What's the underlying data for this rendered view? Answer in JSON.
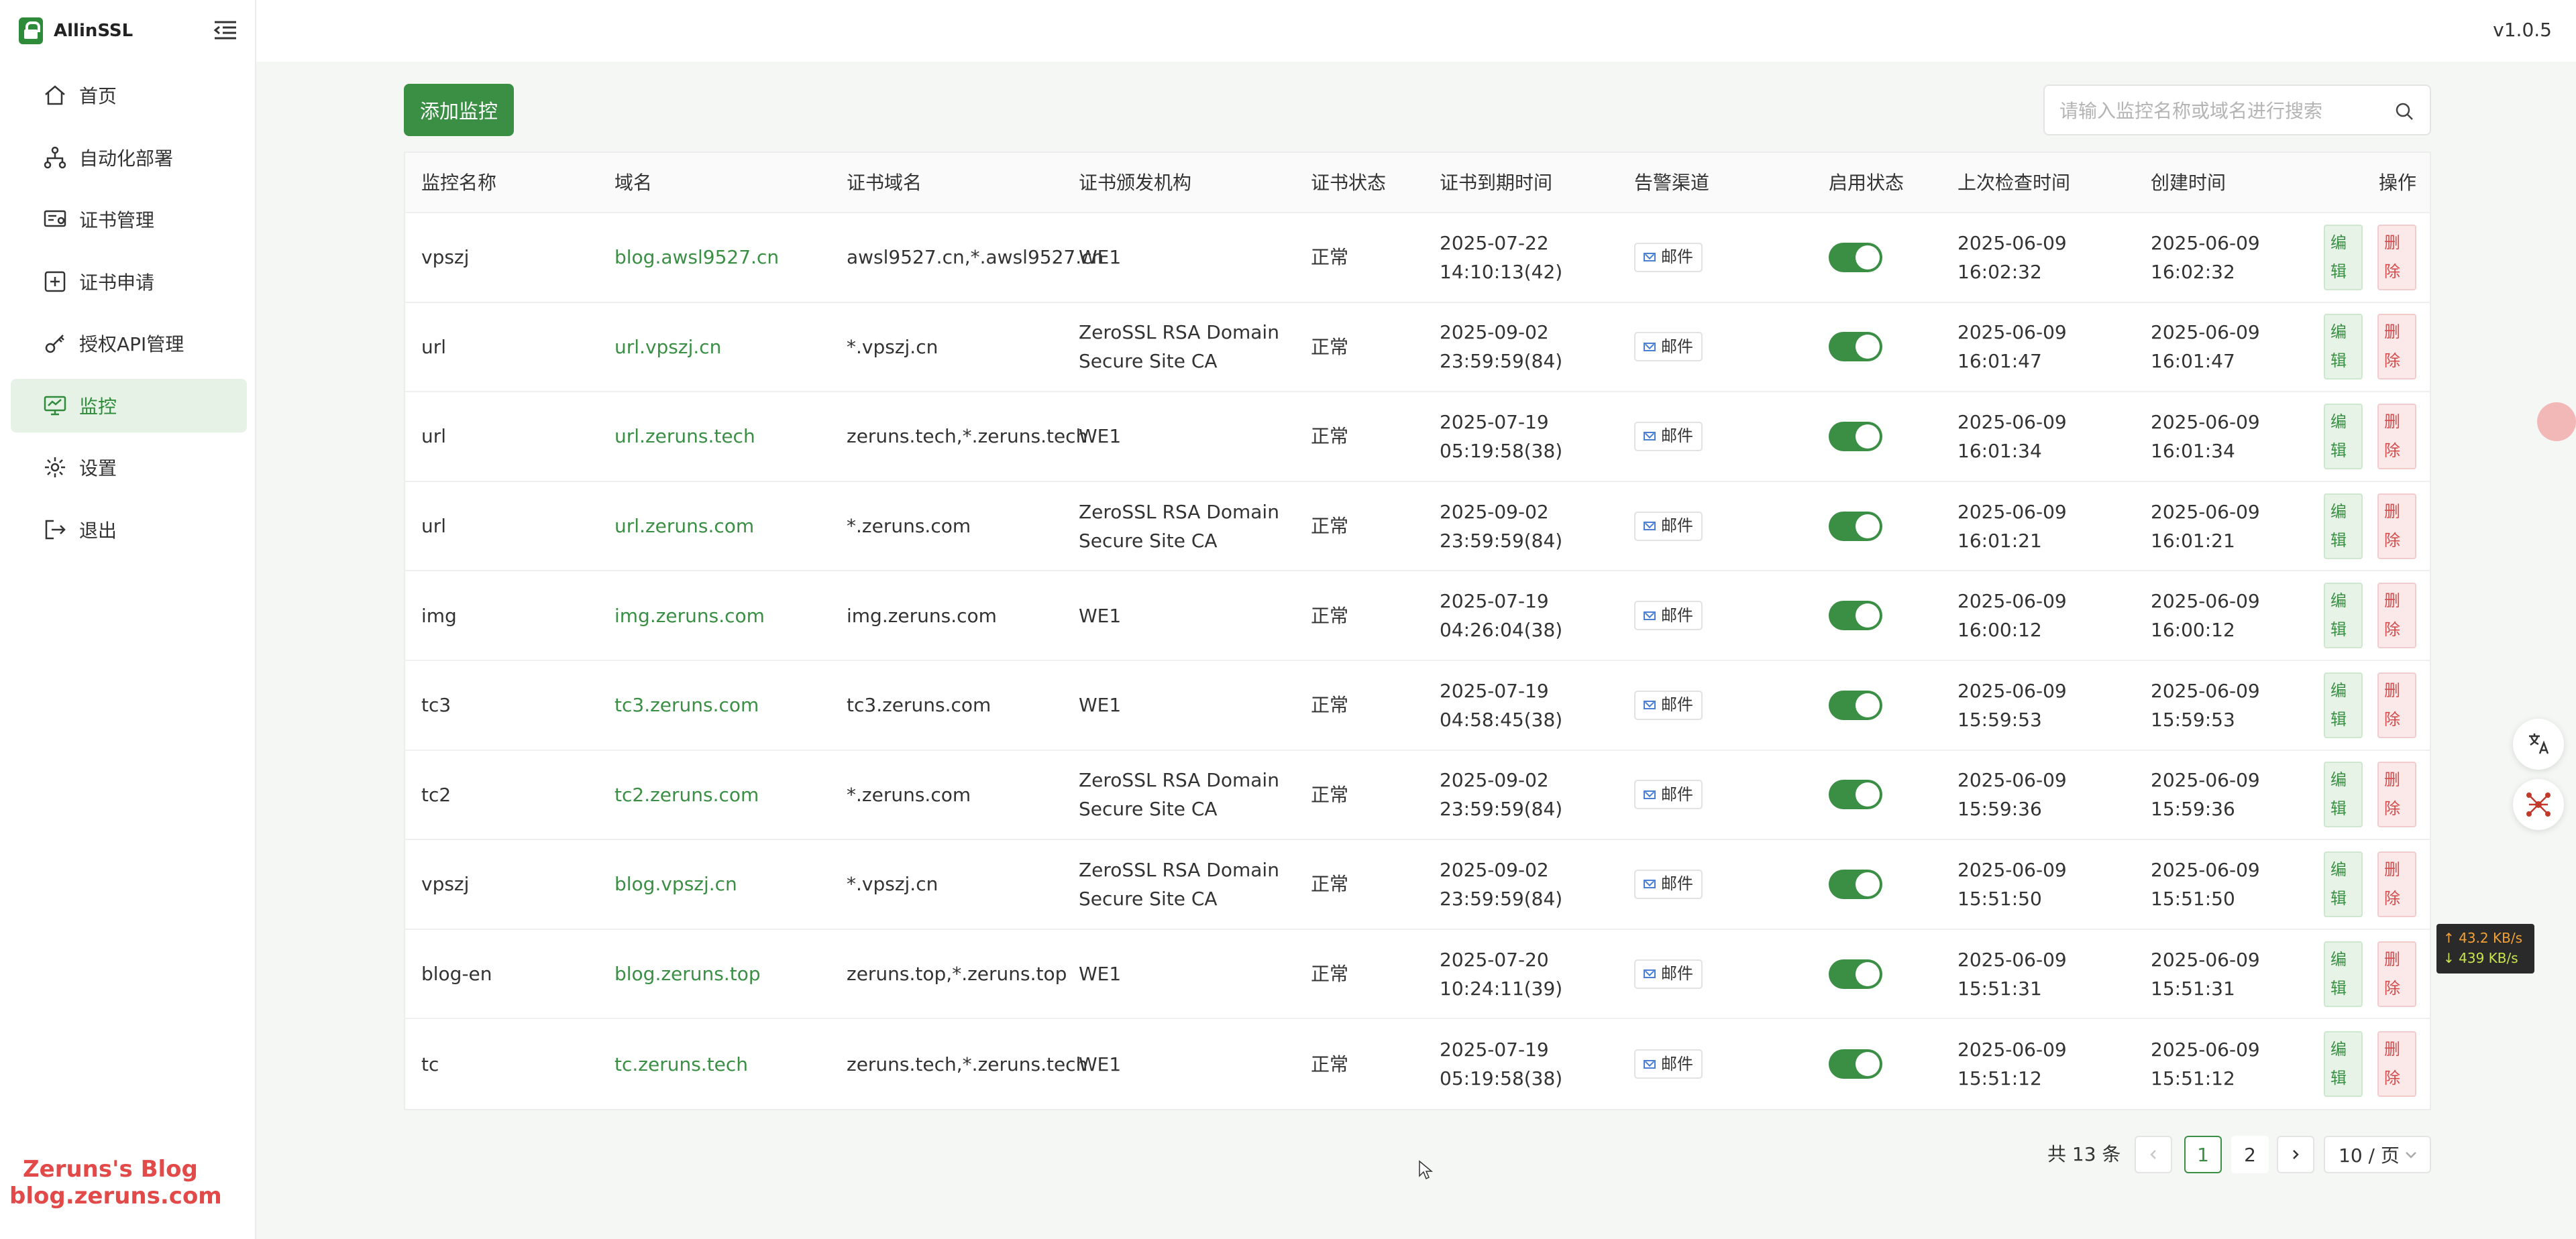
{
  "app": {
    "name": "AllinSSL",
    "version": "v1.0.5"
  },
  "sidebar": {
    "items": [
      {
        "label": "首页",
        "icon": "home-icon"
      },
      {
        "label": "自动化部署",
        "icon": "workflow-icon"
      },
      {
        "label": "证书管理",
        "icon": "certificate-icon"
      },
      {
        "label": "证书申请",
        "icon": "plus-square-icon"
      },
      {
        "label": "授权API管理",
        "icon": "api-key-icon"
      },
      {
        "label": "监控",
        "icon": "monitor-icon",
        "active": true
      },
      {
        "label": "设置",
        "icon": "gear-icon"
      },
      {
        "label": "退出",
        "icon": "logout-icon"
      }
    ]
  },
  "watermark": {
    "line1": "Zeruns's Blog",
    "line2": "blog.zeruns.com"
  },
  "toolbar": {
    "add_label": "添加监控",
    "search_placeholder": "请输入监控名称或域名进行搜索"
  },
  "table": {
    "headers": [
      "监控名称",
      "域名",
      "证书域名",
      "证书颁发机构",
      "证书状态",
      "证书到期时间",
      "告警渠道",
      "启用状态",
      "上次检查时间",
      "创建时间",
      "操作"
    ],
    "edit_label": "编辑",
    "delete_label": "删除",
    "rows": [
      {
        "name": "vpszj",
        "domain": "blog.awsl9527.cn",
        "cert_domain": "awsl9527.cn,*.awsl9527.cn",
        "issuer": "WE1",
        "status": "正常",
        "expire": "2025-07-22 14:10:13(42)",
        "channel": "邮件",
        "enabled": true,
        "last_check": "2025-06-09 16:02:32",
        "created": "2025-06-09 16:02:32"
      },
      {
        "name": "url",
        "domain": "url.vpszj.cn",
        "cert_domain": "*.vpszj.cn",
        "issuer": "ZeroSSL RSA Domain Secure Site CA",
        "status": "正常",
        "expire": "2025-09-02 23:59:59(84)",
        "channel": "邮件",
        "enabled": true,
        "last_check": "2025-06-09 16:01:47",
        "created": "2025-06-09 16:01:47"
      },
      {
        "name": "url",
        "domain": "url.zeruns.tech",
        "cert_domain": "zeruns.tech,*.zeruns.tech",
        "issuer": "WE1",
        "status": "正常",
        "expire": "2025-07-19 05:19:58(38)",
        "channel": "邮件",
        "enabled": true,
        "last_check": "2025-06-09 16:01:34",
        "created": "2025-06-09 16:01:34"
      },
      {
        "name": "url",
        "domain": "url.zeruns.com",
        "cert_domain": "*.zeruns.com",
        "issuer": "ZeroSSL RSA Domain Secure Site CA",
        "status": "正常",
        "expire": "2025-09-02 23:59:59(84)",
        "channel": "邮件",
        "enabled": true,
        "last_check": "2025-06-09 16:01:21",
        "created": "2025-06-09 16:01:21"
      },
      {
        "name": "img",
        "domain": "img.zeruns.com",
        "cert_domain": "img.zeruns.com",
        "issuer": "WE1",
        "status": "正常",
        "expire": "2025-07-19 04:26:04(38)",
        "channel": "邮件",
        "enabled": true,
        "last_check": "2025-06-09 16:00:12",
        "created": "2025-06-09 16:00:12"
      },
      {
        "name": "tc3",
        "domain": "tc3.zeruns.com",
        "cert_domain": "tc3.zeruns.com",
        "issuer": "WE1",
        "status": "正常",
        "expire": "2025-07-19 04:58:45(38)",
        "channel": "邮件",
        "enabled": true,
        "last_check": "2025-06-09 15:59:53",
        "created": "2025-06-09 15:59:53"
      },
      {
        "name": "tc2",
        "domain": "tc2.zeruns.com",
        "cert_domain": "*.zeruns.com",
        "issuer": "ZeroSSL RSA Domain Secure Site CA",
        "status": "正常",
        "expire": "2025-09-02 23:59:59(84)",
        "channel": "邮件",
        "enabled": true,
        "last_check": "2025-06-09 15:59:36",
        "created": "2025-06-09 15:59:36"
      },
      {
        "name": "vpszj",
        "domain": "blog.vpszj.cn",
        "cert_domain": "*.vpszj.cn",
        "issuer": "ZeroSSL RSA Domain Secure Site CA",
        "status": "正常",
        "expire": "2025-09-02 23:59:59(84)",
        "channel": "邮件",
        "enabled": true,
        "last_check": "2025-06-09 15:51:50",
        "created": "2025-06-09 15:51:50"
      },
      {
        "name": "blog-en",
        "domain": "blog.zeruns.top",
        "cert_domain": "zeruns.top,*.zeruns.top",
        "issuer": "WE1",
        "status": "正常",
        "expire": "2025-07-20 10:24:11(39)",
        "channel": "邮件",
        "enabled": true,
        "last_check": "2025-06-09 15:51:31",
        "created": "2025-06-09 15:51:31"
      },
      {
        "name": "tc",
        "domain": "tc.zeruns.tech",
        "cert_domain": "zeruns.tech,*.zeruns.tech",
        "issuer": "WE1",
        "status": "正常",
        "expire": "2025-07-19 05:19:58(38)",
        "channel": "邮件",
        "enabled": true,
        "last_check": "2025-06-09 15:51:12",
        "created": "2025-06-09 15:51:12"
      }
    ]
  },
  "pagination": {
    "total_label": "共 13 条",
    "current": 1,
    "pages": [
      "1",
      "2"
    ],
    "page_size": "10 / 页"
  },
  "netspeed": {
    "up": "↑ 43.2 KB/s",
    "down": "↓ 439 KB/s"
  },
  "colors": {
    "accent": "#3a8f45",
    "danger": "#d64a4a",
    "active_bg": "#e7f2e7"
  }
}
